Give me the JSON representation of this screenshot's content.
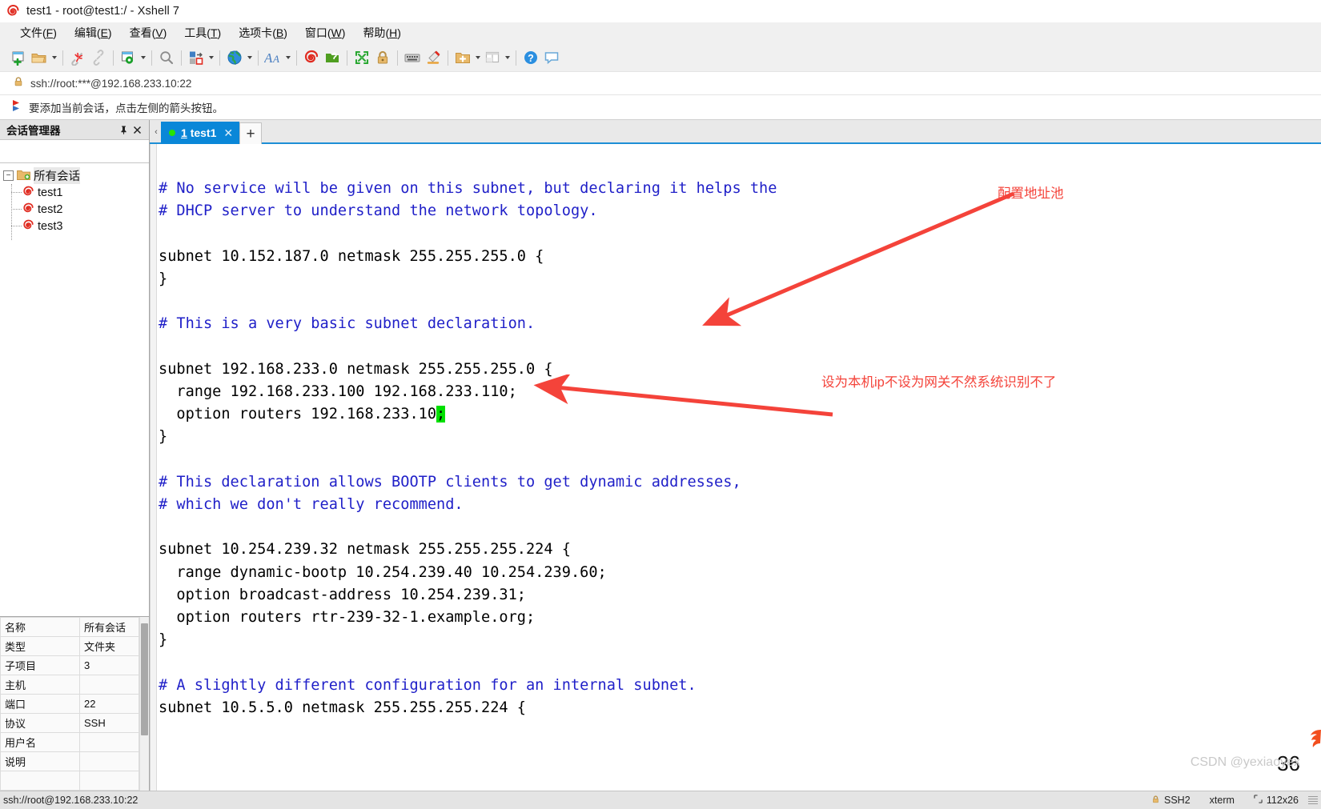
{
  "window": {
    "title": "test1 - root@test1:/ - Xshell 7",
    "logo_icon": "xshell-spiral-logo"
  },
  "menu": {
    "items": [
      {
        "label": "文件",
        "accel": "F"
      },
      {
        "label": "编辑",
        "accel": "E"
      },
      {
        "label": "查看",
        "accel": "V"
      },
      {
        "label": "工具",
        "accel": "T"
      },
      {
        "label": "选项卡",
        "accel": "B"
      },
      {
        "label": "窗口",
        "accel": "W"
      },
      {
        "label": "帮助",
        "accel": "H"
      }
    ]
  },
  "toolbar": {
    "buttons": [
      {
        "name": "new-session-icon",
        "has_caret": false
      },
      {
        "name": "open-folder-icon",
        "has_caret": true
      },
      {
        "name": "disconnect-icon",
        "has_caret": false
      },
      {
        "name": "link-icon",
        "has_caret": false
      },
      {
        "name": "session-properties-icon",
        "has_caret": true
      },
      {
        "name": "find-icon",
        "has_caret": false
      },
      {
        "name": "transfer-file-icon",
        "has_caret": true
      },
      {
        "name": "globe-icon",
        "has_caret": true
      },
      {
        "name": "font-size-icon",
        "has_caret": true
      },
      {
        "name": "xshell-icon",
        "has_caret": false
      },
      {
        "name": "xftp-icon",
        "has_caret": false
      },
      {
        "name": "fullscreen-icon",
        "has_caret": false
      },
      {
        "name": "lock-icon",
        "has_caret": false
      },
      {
        "name": "keyboard-icon",
        "has_caret": false
      },
      {
        "name": "highlight-pen-icon",
        "has_caret": false
      },
      {
        "name": "add-to-folder-icon",
        "has_caret": true
      },
      {
        "name": "layout-icon",
        "has_caret": true
      },
      {
        "name": "help-icon",
        "has_caret": false
      },
      {
        "name": "comment-icon",
        "has_caret": false
      }
    ]
  },
  "address_bar": {
    "lock_icon": "lock-icon",
    "url": "ssh://root:***@192.168.233.10:22"
  },
  "notice_bar": {
    "flag_icon": "red-flag-icon",
    "message": "要添加当前会话，点击左侧的箭头按钮。"
  },
  "sidebar": {
    "header_title": "会话管理器",
    "pin_icon": "pin-icon",
    "close_icon": "close-icon",
    "search_placeholder": "",
    "search_value": "",
    "search_icon": "search-icon",
    "tree": {
      "root": {
        "label": "所有会话",
        "icon": "folder-sessions-icon",
        "expander": "−",
        "selected": true
      },
      "children": [
        {
          "label": "test1",
          "icon": "session-icon"
        },
        {
          "label": "test2",
          "icon": "session-icon"
        },
        {
          "label": "test3",
          "icon": "session-icon"
        }
      ]
    },
    "properties": [
      {
        "key": "名称",
        "value": "所有会话"
      },
      {
        "key": "类型",
        "value": "文件夹"
      },
      {
        "key": "子项目",
        "value": "3"
      },
      {
        "key": "主机",
        "value": ""
      },
      {
        "key": "端口",
        "value": "22"
      },
      {
        "key": "协议",
        "value": "SSH"
      },
      {
        "key": "用户名",
        "value": ""
      },
      {
        "key": "说明",
        "value": ""
      },
      {
        "key": "",
        "value": ""
      }
    ]
  },
  "tabs": {
    "left_arrow": "‹",
    "items": [
      {
        "num": "1",
        "label": "test1",
        "status_dot_color": "#27e500",
        "close_icon": "close-icon",
        "active": true
      }
    ],
    "add_label": "+"
  },
  "terminal": {
    "line_number": "36",
    "lines": [
      {
        "type": "comment",
        "text": "# No service will be given on this subnet, but declaring it helps the"
      },
      {
        "type": "comment",
        "text": "# DHCP server to understand the network topology."
      },
      {
        "type": "blank",
        "text": ""
      },
      {
        "type": "code",
        "text": "subnet 10.152.187.0 netmask 255.255.255.0 {"
      },
      {
        "type": "code",
        "text": "}"
      },
      {
        "type": "blank",
        "text": ""
      },
      {
        "type": "comment",
        "text": "# This is a very basic subnet declaration."
      },
      {
        "type": "blank",
        "text": ""
      },
      {
        "type": "code",
        "text": "subnet 192.168.233.0 netmask 255.255.255.0 {"
      },
      {
        "type": "code",
        "text": "  range 192.168.233.100 192.168.233.110;"
      },
      {
        "type": "cursor-line",
        "before": "  option routers 192.168.233.10",
        "cursor": ";",
        "after": ""
      },
      {
        "type": "code",
        "text": "}"
      },
      {
        "type": "blank",
        "text": ""
      },
      {
        "type": "comment",
        "text": "# This declaration allows BOOTP clients to get dynamic addresses,"
      },
      {
        "type": "comment",
        "text": "# which we don't really recommend."
      },
      {
        "type": "blank",
        "text": ""
      },
      {
        "type": "code",
        "text": "subnet 10.254.239.32 netmask 255.255.255.224 {"
      },
      {
        "type": "code",
        "text": "  range dynamic-bootp 10.254.239.40 10.254.239.60;"
      },
      {
        "type": "code",
        "text": "  option broadcast-address 10.254.239.31;"
      },
      {
        "type": "code",
        "text": "  option routers rtr-239-32-1.example.org;"
      },
      {
        "type": "code",
        "text": "}"
      },
      {
        "type": "blank",
        "text": ""
      },
      {
        "type": "comment",
        "text": "# A slightly different configuration for an internal subnet."
      },
      {
        "type": "code",
        "text": "subnet 10.5.5.0 netmask 255.255.255.224 {"
      }
    ]
  },
  "annotations": [
    {
      "name": "annotation-address-pool",
      "text": "配置地址池",
      "color": "#f4433a"
    },
    {
      "name": "annotation-gateway-note",
      "text": "设为本机ip不设为网关不然系统识别不了",
      "color": "#f4433a"
    }
  ],
  "watermark": "CSDN @yexiaoyex",
  "status_bar": {
    "url": "ssh://root@192.168.233.10:22",
    "lock_icon": "lock-icon",
    "protocol": "SSH2",
    "terminal_type": "xterm",
    "size_icon": "terminal-size-icon",
    "size": "112x26"
  },
  "colors": {
    "accent": "#0a87d8",
    "comment": "#1f1fc8",
    "cursor": "#00e000",
    "annotation": "#f4433a",
    "chrome": "#f0f0f0"
  }
}
